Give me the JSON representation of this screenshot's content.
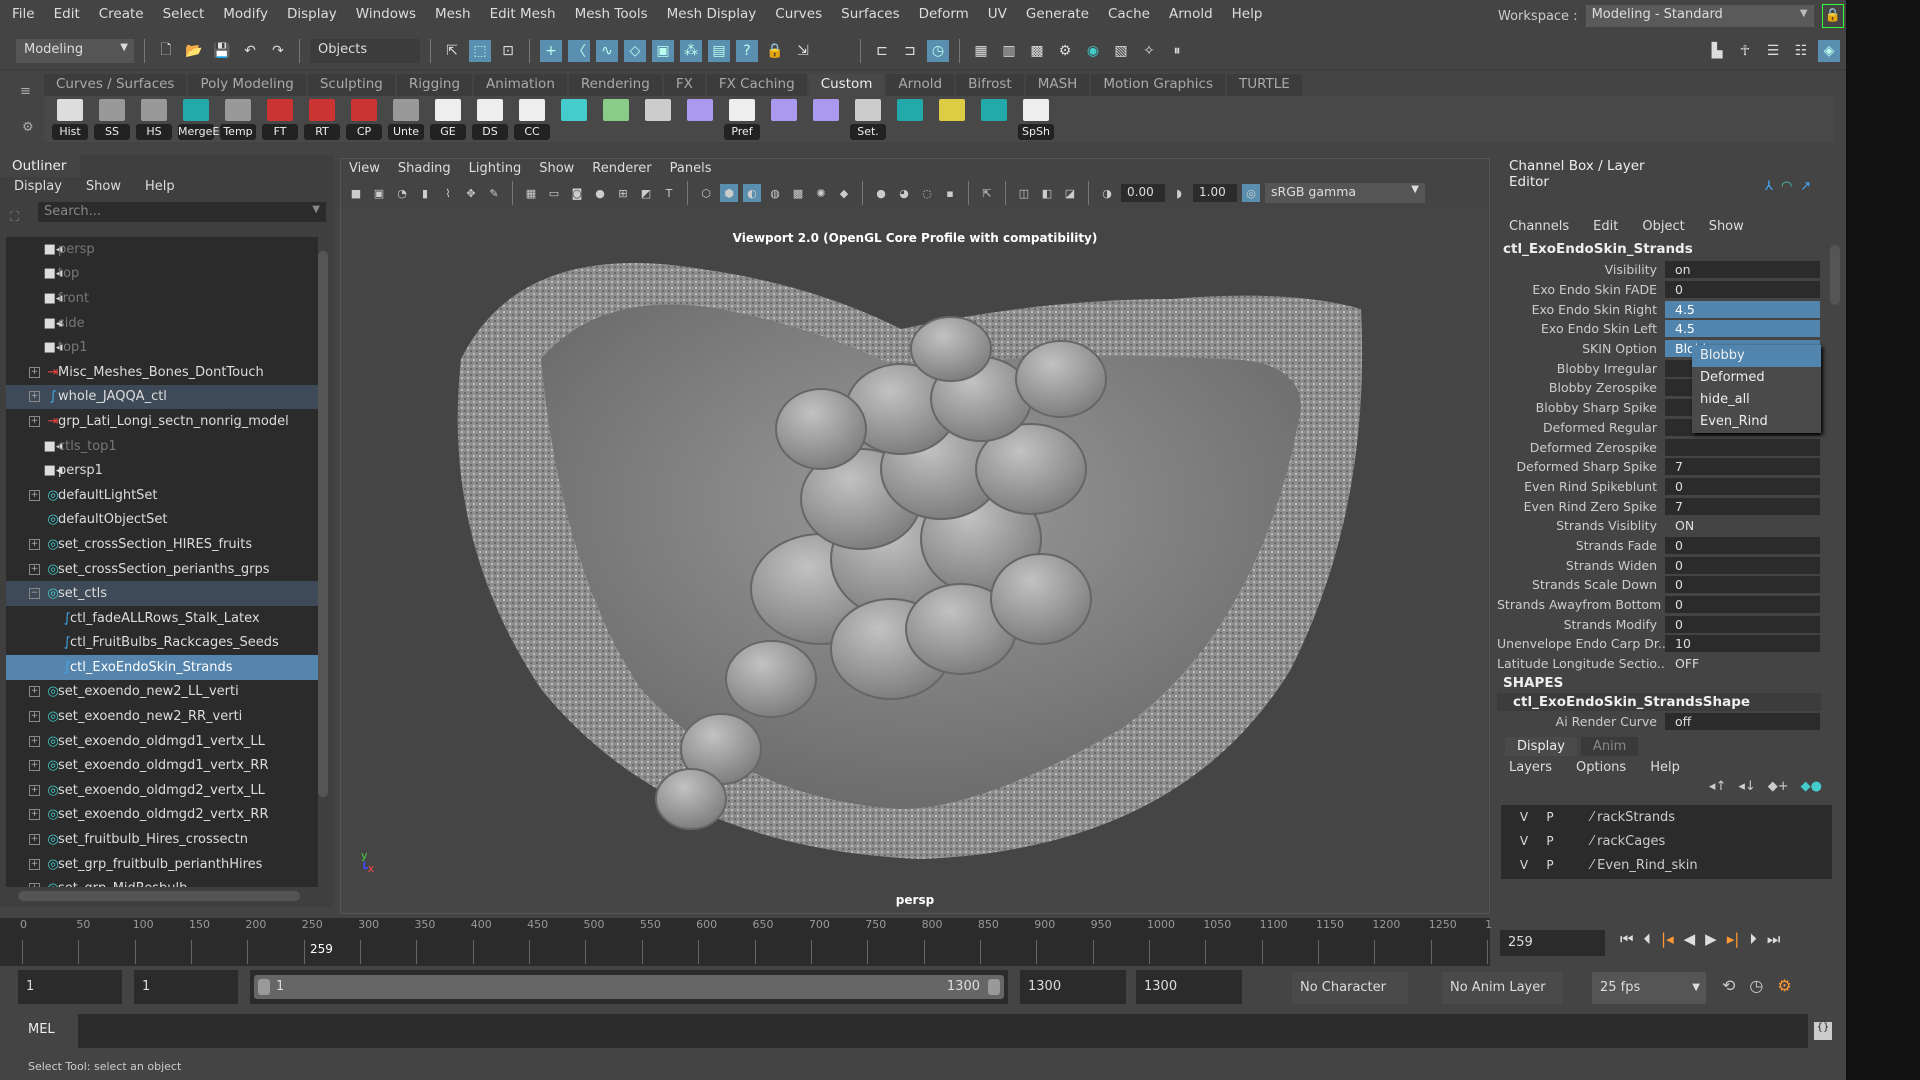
{
  "menubar": [
    "File",
    "Edit",
    "Create",
    "Select",
    "Modify",
    "Display",
    "Windows",
    "Mesh",
    "Edit Mesh",
    "Mesh Tools",
    "Mesh Display",
    "Curves",
    "Surfaces",
    "Deform",
    "UV",
    "Generate",
    "Cache",
    "Arnold",
    "Help"
  ],
  "workspace": {
    "label": "Workspace :",
    "value": "Modeling - Standard"
  },
  "toolbar": {
    "mode": "Modeling",
    "selection_mask": "Objects"
  },
  "shelf": {
    "tabs": [
      "Curves / Surfaces",
      "Poly Modeling",
      "Sculpting",
      "Rigging",
      "Animation",
      "Rendering",
      "FX",
      "FX Caching",
      "Custom",
      "Arnold",
      "Bifrost",
      "MASH",
      "Motion Graphics",
      "TURTLE"
    ],
    "active": "Custom",
    "buttons": [
      "Hist",
      "SS",
      "HS",
      "MergeE",
      "Temp",
      "FT",
      "RT",
      "CP",
      "Unte",
      "GE",
      "DS",
      "CC",
      "",
      "",
      "",
      "",
      "Pref",
      "",
      "",
      "Set.",
      "",
      "",
      "",
      "SpSh"
    ]
  },
  "outliner": {
    "title": "Outliner",
    "menu": [
      "Display",
      "Show",
      "Help"
    ],
    "search_placeholder": "Search...",
    "items": [
      {
        "label": "persp",
        "type": "camera",
        "dim": true
      },
      {
        "label": "top",
        "type": "camera",
        "dim": true
      },
      {
        "label": "front",
        "type": "camera",
        "dim": true
      },
      {
        "label": "side",
        "type": "camera",
        "dim": true
      },
      {
        "label": "top1",
        "type": "camera",
        "dim": true
      },
      {
        "label": "Misc_Meshes_Bones_DontTouch",
        "type": "group",
        "exp": true
      },
      {
        "label": "whole_JAQQA_ctl",
        "type": "curve",
        "exp": true,
        "hl": true
      },
      {
        "label": "grp_Lati_Longi_sectn_nonrig_model",
        "type": "group",
        "exp": true
      },
      {
        "label": "ctls_top1",
        "type": "camera",
        "dim": true
      },
      {
        "label": "persp1",
        "type": "camera"
      },
      {
        "label": "defaultLightSet",
        "type": "set",
        "exp": true
      },
      {
        "label": "defaultObjectSet",
        "type": "set"
      },
      {
        "label": "set_crossSection_HIRES_fruits",
        "type": "set",
        "exp": true
      },
      {
        "label": "set_crossSection_perianths_grps",
        "type": "set",
        "exp": true
      },
      {
        "label": "set_ctls",
        "type": "set",
        "exp": true,
        "open": true,
        "hl": true
      },
      {
        "label": "ctl_fadeALLRows_Stalk_Latex",
        "type": "curve",
        "child": true
      },
      {
        "label": "ctl_FruitBulbs_Rackcages_Seeds",
        "type": "curve",
        "child": true
      },
      {
        "label": "ctl_ExoEndoSkin_Strands",
        "type": "curve",
        "child": true,
        "sel": true
      },
      {
        "label": "set_exoendo_new2_LL_verti",
        "type": "set",
        "exp": true
      },
      {
        "label": "set_exoendo_new2_RR_verti",
        "type": "set",
        "exp": true
      },
      {
        "label": "set_exoendo_oldmgd1_vertx_LL",
        "type": "set",
        "exp": true
      },
      {
        "label": "set_exoendo_oldmgd1_vertx_RR",
        "type": "set",
        "exp": true
      },
      {
        "label": "set_exoendo_oldmgd2_vertx_LL",
        "type": "set",
        "exp": true
      },
      {
        "label": "set_exoendo_oldmgd2_vertx_RR",
        "type": "set",
        "exp": true
      },
      {
        "label": "set_fruitbulb_Hires_crossectn",
        "type": "set",
        "exp": true
      },
      {
        "label": "set_grp_fruitbulb_perianthHires",
        "type": "set",
        "exp": true
      },
      {
        "label": "set_grp_MidResbulb",
        "type": "set",
        "exp": true
      }
    ]
  },
  "viewport": {
    "menu": [
      "View",
      "Shading",
      "Lighting",
      "Show",
      "Renderer",
      "Panels"
    ],
    "exposure": "0.00",
    "gamma": "1.00",
    "color_space": "sRGB gamma",
    "renderer_label": "Viewport 2.0 (OpenGL Core Profile with compatibility)",
    "camera": "persp"
  },
  "channelbox": {
    "title": "Channel Box / Layer Editor",
    "menu": [
      "Channels",
      "Edit",
      "Object",
      "Show"
    ],
    "object": "ctl_ExoEndoSkin_Strands",
    "channels": [
      {
        "k": "Visibility",
        "v": "on"
      },
      {
        "k": "Exo Endo Skin FADE",
        "v": "0"
      },
      {
        "k": "Exo Endo Skin Right",
        "v": "4.5",
        "blue": true
      },
      {
        "k": "Exo Endo Skin Left",
        "v": "4.5",
        "blue": true
      },
      {
        "k": "SKIN Option",
        "v": "Blobby",
        "blue": true
      },
      {
        "k": "Blobby Irregular",
        "v": ""
      },
      {
        "k": "Blobby Zerospike",
        "v": ""
      },
      {
        "k": "Blobby Sharp Spike",
        "v": ""
      },
      {
        "k": "Deformed Regular",
        "v": ""
      },
      {
        "k": "Deformed Zerospike",
        "v": ""
      },
      {
        "k": "Deformed Sharp Spike",
        "v": "7"
      },
      {
        "k": "Even Rind Spikeblunt",
        "v": "0"
      },
      {
        "k": "Even Rind Zero Spike",
        "v": "7"
      },
      {
        "k": "Strands Visiblity",
        "v": "ON",
        "plain": true
      },
      {
        "k": "Strands Fade",
        "v": "0"
      },
      {
        "k": "Strands Widen",
        "v": "0"
      },
      {
        "k": "Strands Scale Down",
        "v": "0"
      },
      {
        "k": "Strands Awayfrom Bottom",
        "v": "0"
      },
      {
        "k": "Strands Modify",
        "v": "0"
      },
      {
        "k": "Unenvelope Endo Carp Dr...",
        "v": "10"
      },
      {
        "k": "Latitude Longitude Sectio...",
        "v": "OFF",
        "plain": true
      }
    ],
    "shapes_label": "SHAPES",
    "shape": "ctl_ExoEndoSkin_StrandsShape",
    "shape_channels": [
      {
        "k": "Ai Render Curve",
        "v": "off"
      }
    ],
    "dropdown": {
      "options": [
        "Blobby",
        "Deformed",
        "hide_all",
        "Even_Rind"
      ],
      "selected": "Blobby"
    }
  },
  "layers": {
    "tabs": [
      "Display",
      "Anim"
    ],
    "menu": [
      "Layers",
      "Options",
      "Help"
    ],
    "items": [
      {
        "name": "rackStrands",
        "v": "V",
        "p": "P"
      },
      {
        "name": "rackCages",
        "v": "V",
        "p": "P"
      },
      {
        "name": "Even_Rind_skin",
        "v": "V",
        "p": "P"
      }
    ]
  },
  "timeline": {
    "ticks": [
      "0",
      "50",
      "100",
      "150",
      "200",
      "250",
      "300",
      "350",
      "400",
      "450",
      "500",
      "550",
      "600",
      "650",
      "700",
      "750",
      "800",
      "850",
      "900",
      "950",
      "1000",
      "1050",
      "1100",
      "1150",
      "1200",
      "1250",
      "1"
    ],
    "current": "259",
    "current_field": "259"
  },
  "range": {
    "start": "1",
    "anim_start": "1",
    "slider_start": "1",
    "slider_end": "1300",
    "end": "1300",
    "anim_end": "1300",
    "character_set": "No Character Set",
    "anim_layer": "No Anim Layer",
    "fps": "25 fps"
  },
  "mel": {
    "label": "MEL"
  },
  "help_line": "Select Tool: select an object"
}
